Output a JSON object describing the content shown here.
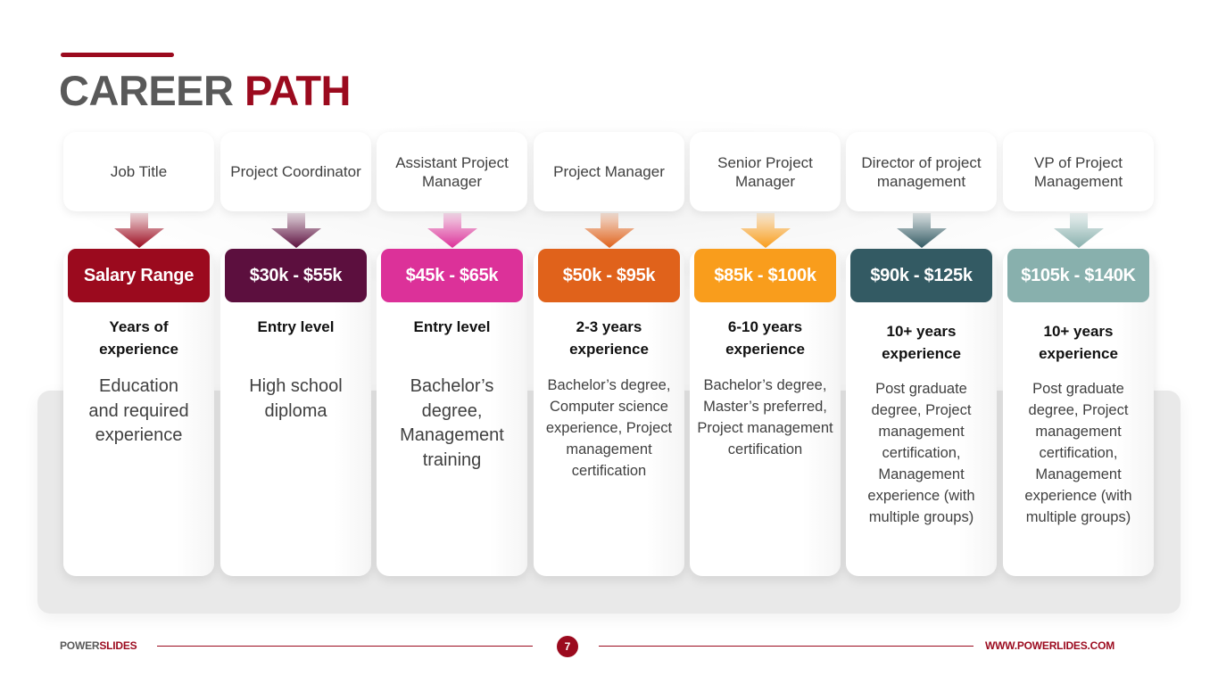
{
  "title": {
    "part1": "CAREER",
    "part2": "PATH"
  },
  "colors": {
    "accent": "#9b0a1e",
    "title_gray": "#595959"
  },
  "columns": [
    {
      "job_title": "Job Title",
      "salary": "Salary Range",
      "experience": "Years of experience",
      "requirements": "Education and required experience",
      "color": "#9b0a1e"
    },
    {
      "job_title": "Project Coordinator",
      "salary": "$30k - $55k",
      "experience": "Entry level",
      "requirements": "High school diploma",
      "color": "#5c0f3e"
    },
    {
      "job_title": "Assistant Project Manager",
      "salary": "$45k - $65k",
      "experience": "Entry level",
      "requirements": "Bachelor’s degree, Management training",
      "color": "#dc3199"
    },
    {
      "job_title": "Project Manager",
      "salary": "$50k - $95k",
      "experience": "2-3 years experience",
      "requirements": "Bachelor’s degree, Computer science experience, Project management certification",
      "color": "#e0621b"
    },
    {
      "job_title": "Senior Project Manager",
      "salary": "$85k - $100k",
      "experience": "6-10 years experience",
      "requirements": "Bachelor’s degree, Master’s preferred, Project management certification",
      "color": "#f99d1c"
    },
    {
      "job_title": "Director of project management",
      "salary": "$90k - $125k",
      "experience": "10+ years experience",
      "requirements": "Post graduate degree, Project management certification, Management experience (with multiple groups)",
      "color": "#335a63"
    },
    {
      "job_title": "VP of Project Management",
      "salary": "$105k - $140K",
      "experience": "10+ years experience",
      "requirements": "Post graduate degree, Project management certification, Management experience (with multiple groups)",
      "color": "#88b0ad"
    }
  ],
  "footer": {
    "brand_part1": "POWER",
    "brand_part2": "SLIDES",
    "page_number": "7",
    "url": "WWW.POWERLIDES.COM"
  }
}
